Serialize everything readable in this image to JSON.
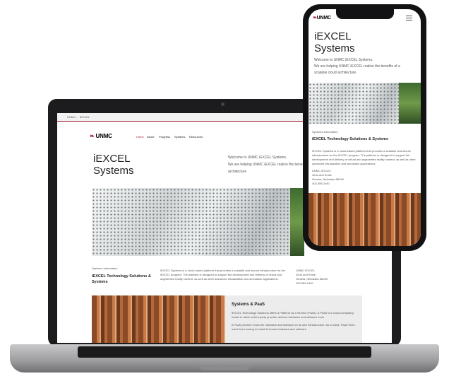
{
  "brand": {
    "logo": "UNMC",
    "color": "#a6192e"
  },
  "laptop": {
    "topbar": {
      "left": "UNMC",
      "right": "iEXCEL"
    },
    "nav": {
      "items": [
        "Home",
        "About",
        "Progress",
        "Systems",
        "Resources"
      ]
    },
    "title_line1": "iEXCEL",
    "title_line2": "Systems",
    "welcome": "Welcome to UNMC iEXCEL Systems.",
    "helping": "We are helping UNMC iEXCEL realize the benefits of a scalable cloud",
    "helping2": "architecture",
    "info_label": "Systems Information",
    "info_title": "iEXCEL Technology Solutions & Systems",
    "info_body": "iEXCEL Systems is a cloud-based platform that provides a scalable and secure infrastructure for the iEXCEL program. The platform is designed to support the development and delivery of virtual and augmented reality content, as well as other advanced visualization and simulation applications.",
    "address": {
      "line1": "UNMC iEXCEL",
      "line2": "42nd and Emile",
      "line3": "Omaha, Nebraska 68198",
      "line4": "402.559.2440"
    },
    "paas_title": "Systems & PaaS",
    "paas_body1": "iEXCEL Technology Solutions offers a Platform as a Service (PaaS). A PaaS is a cloud computing model in which a third-party provider delivers hardware and software tools.",
    "paas_body2": "A PaaS provider hosts the hardware and software on its own infrastructure. As a result, PaaS frees users from having to install in-house hardware and software."
  },
  "phone": {
    "logo": "UNMC",
    "menu_icon": "hamburger-icon",
    "title_line1": "iEXCEL",
    "title_line2": "Systems",
    "welcome": "Welcome to UNMC iEXCEL Systems.",
    "helping": "We are helping UNMC iEXCEL realize the benefits of a",
    "helping2": "scalable cloud architecture",
    "info_label": "Systems Information",
    "info_title": "iEXCEL Technology Solutions & Systems",
    "info_body": "iEXCEL Systems is a cloud-based platform that provides a scalable and secure infrastructure for the iEXCEL program. The platform is designed to support the development and delivery of virtual and augmented reality content, as well as other advanced visualization and simulation applications.",
    "address": {
      "line1": "UNMC iEXCEL",
      "line2": "42nd and Emile",
      "line3": "Omaha, Nebraska 68198",
      "line4": "402.559.2440"
    }
  }
}
